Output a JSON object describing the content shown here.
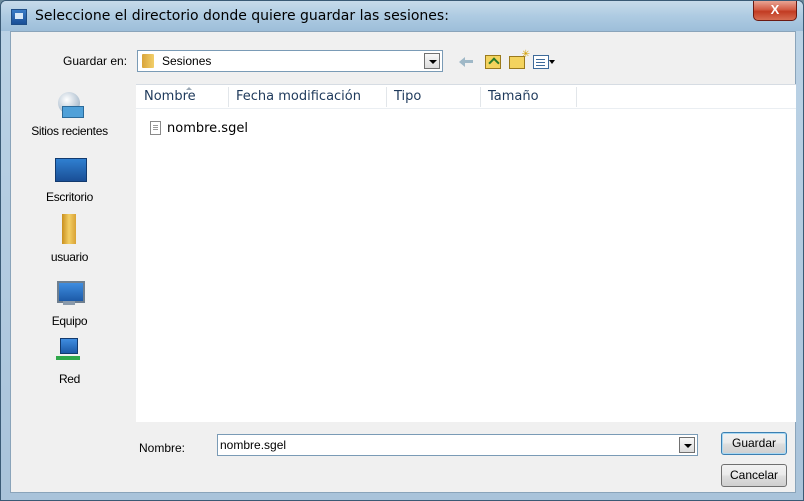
{
  "window": {
    "title": "Seleccione el directorio donde quiere guardar las sesiones:",
    "close_label": "X"
  },
  "lookin": {
    "label": "Guardar en:",
    "value": "Sesiones",
    "icon": "folder-icon"
  },
  "toolbar": {
    "icons": [
      "back-arrow-icon",
      "up-folder-icon",
      "new-folder-icon",
      "views-menu-icon"
    ]
  },
  "places": [
    {
      "label": "Sitios recientes",
      "icon": "recent-places-icon"
    },
    {
      "label": "Escritorio",
      "icon": "desktop-icon"
    },
    {
      "label": "usuario",
      "icon": "user-folder-icon"
    },
    {
      "label": "Equipo",
      "icon": "computer-icon"
    },
    {
      "label": "Red",
      "icon": "network-icon"
    }
  ],
  "filelist": {
    "columns": [
      "Nombre",
      "Fecha modificación",
      "Tipo",
      "Tamaño"
    ],
    "rows": [
      {
        "name": "nombre.sgel",
        "icon": "document-icon"
      }
    ]
  },
  "filename": {
    "label": "Nombre:",
    "value": "nombre.sgel"
  },
  "buttons": {
    "save": "Guardar",
    "cancel": "Cancelar"
  }
}
